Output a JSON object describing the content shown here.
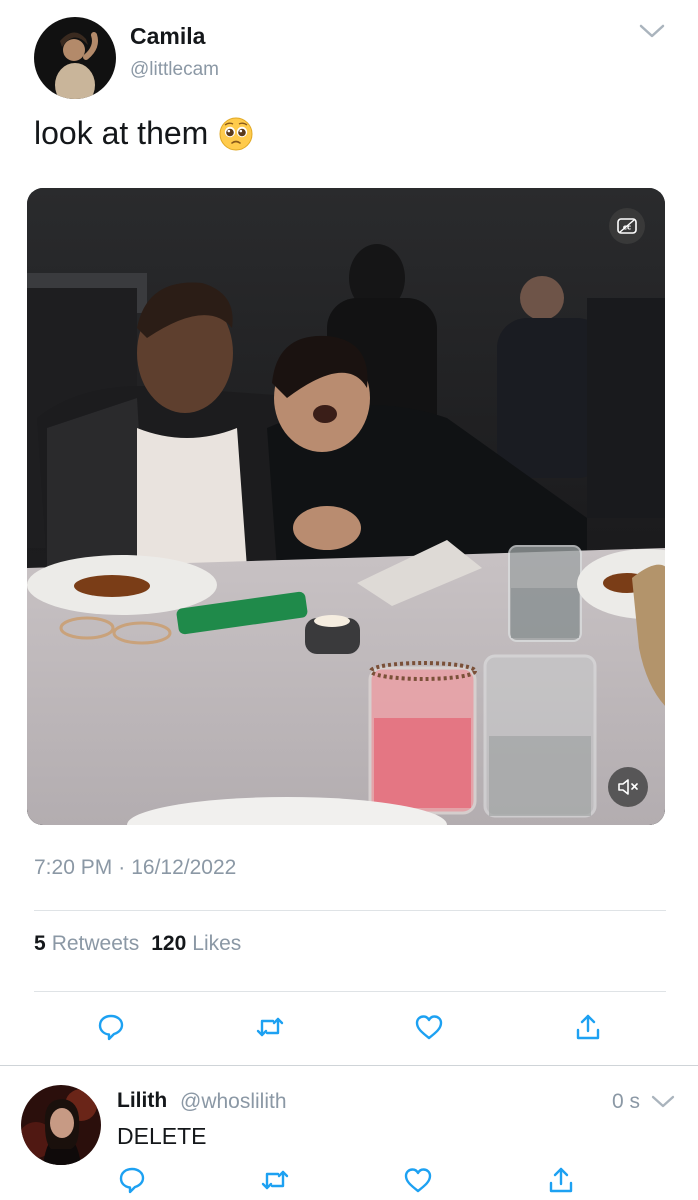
{
  "tweet": {
    "author_name": "Camila",
    "author_handle": "@littlecam",
    "text": "look at them",
    "emoji_icon": "pleading-face-emoji",
    "time": "7:20 PM",
    "separator": "·",
    "date": "16/12/2022",
    "retweets_count": "5",
    "retweets_label": "Retweets",
    "likes_count": "120",
    "likes_label": "Likes"
  },
  "reply": {
    "author_name": "Lilith",
    "author_handle": "@whoslilith",
    "time": "0 s",
    "text": "DELETE"
  },
  "colors": {
    "accent": "#1da1f2",
    "text": "#14171a",
    "secondary_text": "#8b98a5",
    "divider": "#dfe3e6"
  },
  "icons": {
    "reply": "reply-icon",
    "retweet": "retweet-icon",
    "like": "heart-icon",
    "share": "share-icon",
    "more": "chevron-down-icon",
    "captions": "closed-captions-icon",
    "mute": "muted-speaker-icon"
  }
}
